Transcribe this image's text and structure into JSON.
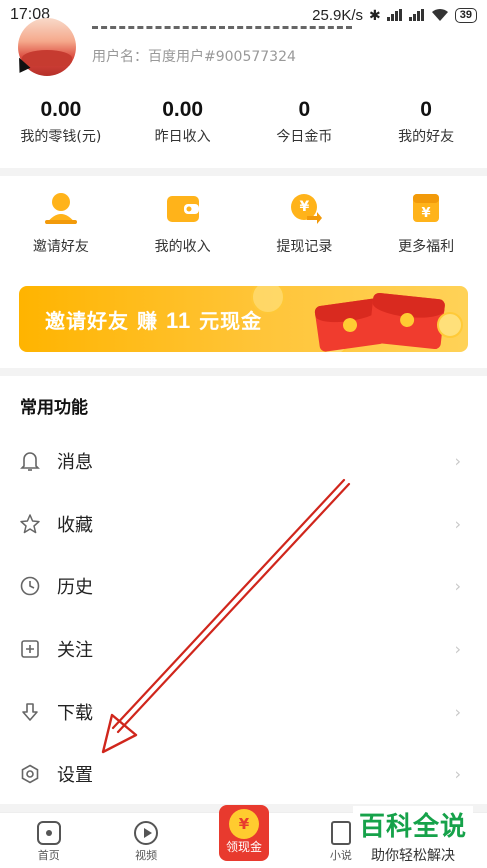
{
  "status_bar": {
    "time": "17:08",
    "network_speed": "25.9K/s",
    "battery": "39"
  },
  "profile": {
    "username": "用户名：百度用户#900577324"
  },
  "stats": [
    {
      "value": "0.00",
      "label": "我的零钱(元)"
    },
    {
      "value": "0.00",
      "label": "昨日收入"
    },
    {
      "value": "0",
      "label": "今日金币"
    },
    {
      "value": "0",
      "label": "我的好友"
    }
  ],
  "quick_actions": [
    {
      "label": "邀请好友",
      "icon": "person-icon"
    },
    {
      "label": "我的收入",
      "icon": "wallet-icon"
    },
    {
      "label": "提现记录",
      "icon": "coin-icon"
    },
    {
      "label": "更多福利",
      "icon": "gift-icon"
    }
  ],
  "banner": {
    "part1": "邀请好友 赚",
    "amount": "11",
    "part2": "元现金"
  },
  "section_title": "常用功能",
  "menu": [
    {
      "label": "消息",
      "icon": "bell-icon"
    },
    {
      "label": "收藏",
      "icon": "star-icon"
    },
    {
      "label": "历史",
      "icon": "clock-icon"
    },
    {
      "label": "关注",
      "icon": "plus-box-icon"
    },
    {
      "label": "下载",
      "icon": "download-icon"
    },
    {
      "label": "设置",
      "icon": "settings-hexagon-icon"
    }
  ],
  "tabs": [
    {
      "label": "首页"
    },
    {
      "label": "视频"
    },
    {
      "label": "领现金"
    },
    {
      "label": "小说"
    }
  ],
  "watermark": {
    "title": "百科全说",
    "subtitle": "助你轻松解决"
  },
  "colors": {
    "accent": "#ffb400",
    "annotation_arrow": "#d0261c",
    "watermark_green": "#16a24a"
  }
}
